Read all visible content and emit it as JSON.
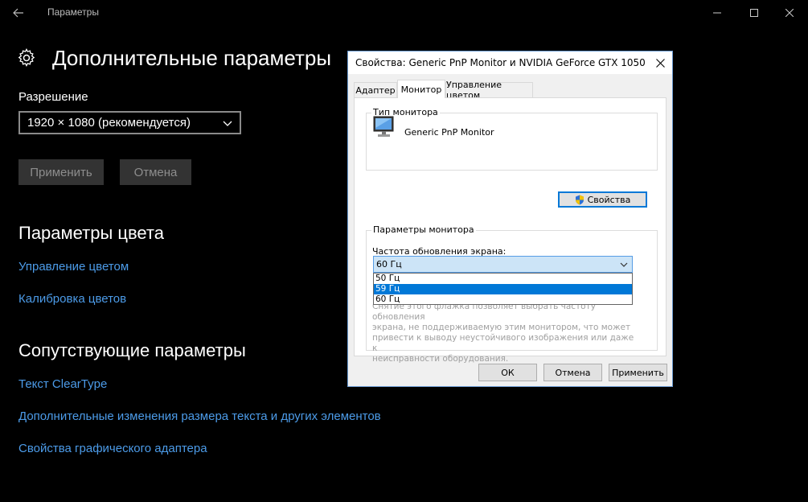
{
  "settings": {
    "app_title": "Параметры",
    "page_title": "Дополнительные параметры",
    "resolution_label": "Разрешение",
    "resolution_value": "1920 × 1080 (рекомендуется)",
    "apply_label": "Применить",
    "cancel_label": "Отмена",
    "color_section_title": "Параметры цвета",
    "color_links": [
      "Управление цветом",
      "Калибровка цветов"
    ],
    "related_section_title": "Сопутствующие параметры",
    "related_links": [
      "Текст ClearType",
      "Дополнительные изменения размера текста и других элементов",
      "Свойства графического адаптера"
    ]
  },
  "dialog": {
    "title": "Свойства: Generic PnP Monitor и NVIDIA GeForce GTX 1050",
    "tabs": [
      "Адаптер",
      "Монитор",
      "Управление цветом"
    ],
    "active_tab": "Монитор",
    "monitor_type_caption": "Тип монитора",
    "monitor_name": "Generic PnP Monitor",
    "properties_button": "Свойства",
    "monitor_params_caption": "Параметры монитора",
    "refresh_label": "Частота обновления экрана:",
    "refresh_value": "60 Гц",
    "refresh_options": [
      "50 Гц",
      "59 Гц",
      "60 Гц"
    ],
    "refresh_highlighted": "59 Гц",
    "description_lines": [
      "Снятие этого флажка позволяет выбрать частоту обновления",
      "экрана, не поддерживаемую этим монитором, что может",
      "привести к выводу неустойчивого изображения или даже к",
      "неисправности оборудования."
    ],
    "ok_label": "ОК",
    "cancel_label": "Отмена",
    "apply_label": "Применить"
  },
  "colors": {
    "background": "#000000",
    "link": "#4c9be8",
    "dark_button": "#333333",
    "dialog_bg": "#f0f0f0",
    "selection": "#0078d7",
    "combo_bg": "#cce4f7"
  }
}
